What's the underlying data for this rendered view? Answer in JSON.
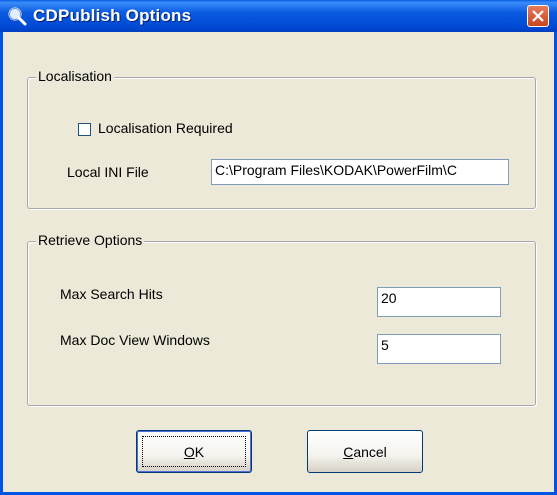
{
  "window": {
    "title": "CDPublish Options",
    "icon": "magnifier-icon",
    "close_icon": "close-icon"
  },
  "localisation": {
    "group_label": "Localisation",
    "checkbox_label": "Localisation Required",
    "checkbox_checked": false,
    "ini_label": "Local INI File",
    "ini_value": "C:\\Program Files\\KODAK\\PowerFilm\\C"
  },
  "retrieve": {
    "group_label": "Retrieve Options",
    "max_search_label": "Max Search Hits",
    "max_search_value": "20",
    "max_doc_label": "Max Doc View Windows",
    "max_doc_value": "5"
  },
  "buttons": {
    "ok_mnemonic": "O",
    "ok_rest": "K",
    "cancel_mnemonic": "C",
    "cancel_rest": "ancel"
  },
  "colors": {
    "titlebar": "#0054e3",
    "face": "#ece9d8",
    "close": "#c9461f"
  }
}
